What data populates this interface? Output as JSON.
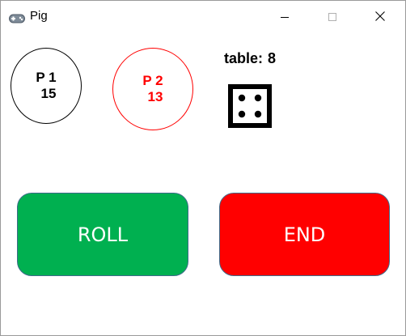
{
  "window": {
    "title": "Pig",
    "app_icon": "gamepad-icon",
    "controls": [
      "minimize-icon",
      "maximize-icon",
      "close-icon"
    ]
  },
  "players": [
    {
      "label": "P 1",
      "score": "15",
      "color": "#000000"
    },
    {
      "label": "P 2",
      "score": "13",
      "color": "#ff0000"
    }
  ],
  "table": {
    "label": "table:",
    "value": "8"
  },
  "die": {
    "face": 4,
    "icon": "die-face-4-icon"
  },
  "buttons": {
    "roll_label": "ROLL",
    "roll_color": "#00b050",
    "end_label": "END",
    "end_color": "#ff0000"
  }
}
